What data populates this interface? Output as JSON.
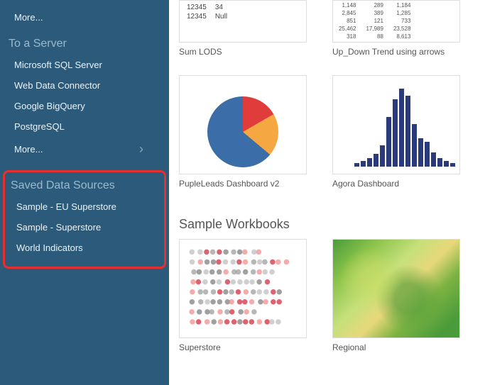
{
  "sidebar": {
    "topMore": "More...",
    "serverHeader": "To a Server",
    "servers": [
      "Microsoft SQL Server",
      "Web Data Connector",
      "Google BigQuery",
      "PostgreSQL"
    ],
    "serversMore": "More...",
    "savedHeader": "Saved Data Sources",
    "saved": [
      "Sample - EU Superstore",
      "Sample - Superstore",
      "World Indicators"
    ]
  },
  "thumbs": {
    "sumLods": "Sum LODS",
    "upDown": "Up_Down Trend using arrows",
    "puple": "PupleLeads Dashboard v2",
    "agora": "Agora Dashboard",
    "super": "Superstore",
    "regional": "Regional"
  },
  "sampleHeader": "Sample Workbooks",
  "lodsTable": [
    [
      "12345",
      "34"
    ],
    [
      "12345",
      "Null"
    ]
  ],
  "chart_data": {
    "type": "bar",
    "title": "Agora Dashboard",
    "values": [
      5,
      8,
      12,
      18,
      30,
      70,
      95,
      110,
      100,
      60,
      40,
      35,
      20,
      12,
      8,
      5
    ],
    "ylim": [
      0,
      120
    ]
  }
}
